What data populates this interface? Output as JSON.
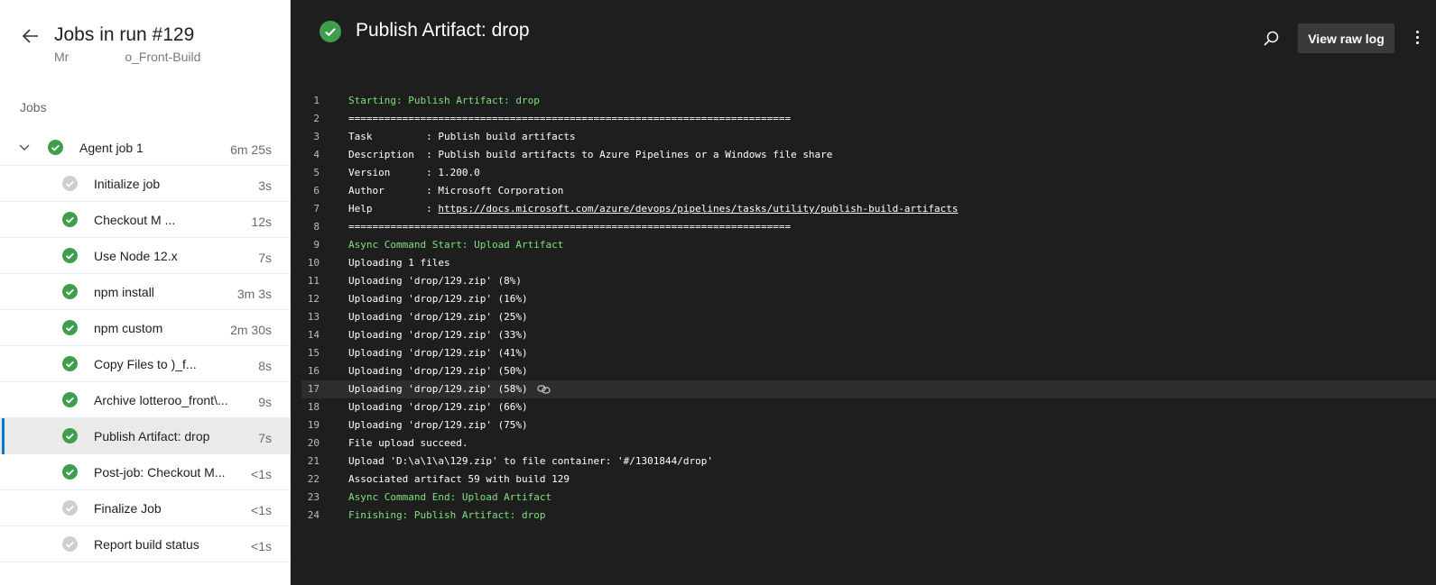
{
  "header": {
    "title": "Jobs in run #129",
    "subtitle_left": "Mr",
    "subtitle_right": "o_Front-Build",
    "jobs_label": "Jobs"
  },
  "jobs": [
    {
      "name": "Agent job 1",
      "duration": "6m 25s",
      "status": "success",
      "parent": true
    },
    {
      "name": "Initialize job",
      "duration": "3s",
      "status": "skipped"
    },
    {
      "name": "Checkout M                 ...",
      "duration": "12s",
      "status": "success"
    },
    {
      "name": "Use Node 12.x",
      "duration": "7s",
      "status": "success"
    },
    {
      "name": "npm install",
      "duration": "3m 3s",
      "status": "success"
    },
    {
      "name": "npm custom",
      "duration": "2m 30s",
      "status": "success"
    },
    {
      "name": "Copy Files to               )_f...",
      "duration": "8s",
      "status": "success"
    },
    {
      "name": "Archive lotteroo_front\\...",
      "duration": "9s",
      "status": "success"
    },
    {
      "name": "Publish Artifact: drop",
      "duration": "7s",
      "status": "success",
      "selected": true
    },
    {
      "name": "Post-job: Checkout M...",
      "duration": "<1s",
      "status": "success"
    },
    {
      "name": "Finalize Job",
      "duration": "<1s",
      "status": "skipped"
    },
    {
      "name": "Report build status",
      "duration": "<1s",
      "status": "skipped"
    }
  ],
  "step": {
    "title": "Publish Artifact: drop",
    "view_raw_label": "View raw log"
  },
  "log": [
    {
      "n": "1",
      "text": "Starting: Publish Artifact: drop",
      "color": "green"
    },
    {
      "n": "2",
      "text": "==========================================================================",
      "color": "white"
    },
    {
      "n": "3",
      "text": "Task         : Publish build artifacts",
      "color": "white"
    },
    {
      "n": "4",
      "text": "Description  : Publish build artifacts to Azure Pipelines or a Windows file share",
      "color": "white"
    },
    {
      "n": "5",
      "text": "Version      : 1.200.0",
      "color": "white"
    },
    {
      "n": "6",
      "text": "Author       : Microsoft Corporation",
      "color": "white"
    },
    {
      "n": "7",
      "text": "Help         : ",
      "link": "https://docs.microsoft.com/azure/devops/pipelines/tasks/utility/publish-build-artifacts",
      "color": "white"
    },
    {
      "n": "8",
      "text": "==========================================================================",
      "color": "white"
    },
    {
      "n": "9",
      "text": "Async Command Start: Upload Artifact",
      "color": "green"
    },
    {
      "n": "10",
      "text": "Uploading 1 files",
      "color": "white"
    },
    {
      "n": "11",
      "text": "Uploading 'drop/129.zip' (8%)",
      "color": "white"
    },
    {
      "n": "12",
      "text": "Uploading 'drop/129.zip' (16%)",
      "color": "white"
    },
    {
      "n": "13",
      "text": "Uploading 'drop/129.zip' (25%)",
      "color": "white"
    },
    {
      "n": "14",
      "text": "Uploading 'drop/129.zip' (33%)",
      "color": "white"
    },
    {
      "n": "15",
      "text": "Uploading 'drop/129.zip' (41%)",
      "color": "white"
    },
    {
      "n": "16",
      "text": "Uploading 'drop/129.zip' (50%)",
      "color": "white"
    },
    {
      "n": "17",
      "text": "Uploading 'drop/129.zip' (58%)",
      "color": "white",
      "highlight": true
    },
    {
      "n": "18",
      "text": "Uploading 'drop/129.zip' (66%)",
      "color": "white"
    },
    {
      "n": "19",
      "text": "Uploading 'drop/129.zip' (75%)",
      "color": "white"
    },
    {
      "n": "20",
      "text": "File upload succeed.",
      "color": "white"
    },
    {
      "n": "21",
      "text": "Upload 'D:\\a\\1\\a\\129.zip' to file container: '#/1301844/drop'",
      "color": "white"
    },
    {
      "n": "22",
      "text": "Associated artifact 59 with build 129",
      "color": "white"
    },
    {
      "n": "23",
      "text": "Async Command End: Upload Artifact",
      "color": "green"
    },
    {
      "n": "24",
      "text": "Finishing: Publish Artifact: drop",
      "color": "green"
    }
  ],
  "colors": {
    "success": "#3f9e4c",
    "skipped": "#cfcfcf",
    "accent": "#0078d4",
    "log_green": "#7ee07e"
  }
}
